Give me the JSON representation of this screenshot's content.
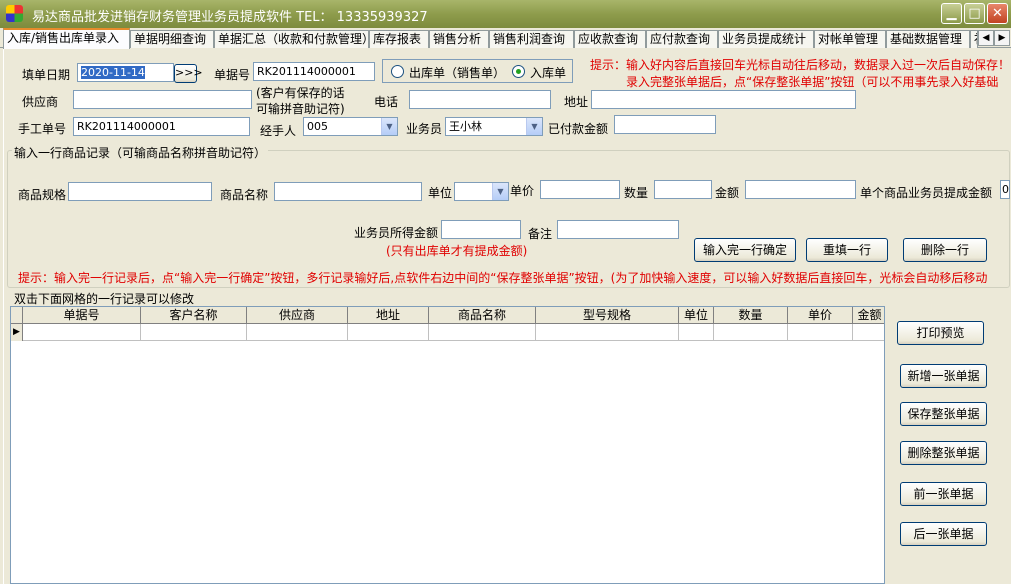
{
  "window": {
    "title": "易达商品批发进销存财务管理业务员提成软件 TEL： 13335939327",
    "min_label": "▁",
    "max_label": "□",
    "close_label": "✕"
  },
  "tabs": [
    {
      "label": "入库/销售出库单录入"
    },
    {
      "label": "单据明细查询"
    },
    {
      "label": "单据汇总（收款和付款管理）"
    },
    {
      "label": "库存报表"
    },
    {
      "label": "销售分析"
    },
    {
      "label": "销售利润查询"
    },
    {
      "label": "应收款查询"
    },
    {
      "label": "应付款查询"
    },
    {
      "label": "业务员提成统计"
    },
    {
      "label": "对帐单管理"
    },
    {
      "label": "基础数据管理"
    },
    {
      "label": "补"
    }
  ],
  "tab_scroll": {
    "left": "◀",
    "right": "▶"
  },
  "header": {
    "date_label": "填单日期",
    "date_value": "2020-11-14",
    "date_button": ">>>",
    "bill_no_label": "单据号",
    "bill_no_value": "RK201114000001",
    "radio_out_label": "出库单（销售单）",
    "radio_in_label": "入库单",
    "radio_selected": "入库单",
    "tip_line1": "提示：输入好内容后直接回车光标自动往后移动，数据录入过一次后自动保存！",
    "tip_line2": "录入完整张单据后，点“保存整张单据”按钮（可以不用事先录入好基础",
    "supplier_label": "供应商",
    "supplier_value": "",
    "supplier_hint_line1": "(客户有保存的话",
    "supplier_hint_line2": "可输拼音助记符)",
    "phone_label": "电话",
    "phone_value": "",
    "address_label": "地址",
    "address_value": "",
    "manual_no_label": "手工单号",
    "manual_no_value": "RK201114000001",
    "handler_label": "经手人",
    "handler_value": "005",
    "salesman_label": "业务员",
    "salesman_value": "王小林",
    "paid_label": "已付款金额",
    "paid_value": ""
  },
  "item_group": {
    "title": "输入一行商品记录（可输商品名称拼音助记符）",
    "spec_label": "商品规格",
    "name_label": "商品名称",
    "unit_label": "单位",
    "price_label": "单价",
    "qty_label": "数量",
    "amount_label": "金额",
    "commission_label": "单个商品业务员提成金额",
    "commission_value": "0",
    "salesman_amount_label": "业务员所得金额",
    "remark_label": "备注",
    "commission_note": "(只有出库单才有提成金额)",
    "confirm_button": "输入完一行确定",
    "refill_button": "重填一行",
    "delete_button": "删除一行",
    "bottom_tip": "提示：输入完一行记录后，点“输入完一行确定”按钮，多行记录输好后,点软件右边中间的“保存整张单据”按钮，(为了加快输入速度，可以输入好数据后直接回车，光标会自动移后移动"
  },
  "grid": {
    "caption": "双击下面网格的一行记录可以修改",
    "columns": [
      "单据号",
      "客户名称",
      "供应商",
      "地址",
      "商品名称",
      "型号规格",
      "单位",
      "数量",
      "单价",
      "金额"
    ],
    "row_indicator": "▶"
  },
  "side_buttons": {
    "print": "打印预览",
    "new_bill": "新增一张单据",
    "save_bill": "保存整张单据",
    "delete_bill": "删除整张单据",
    "prev_bill": "前一张单据",
    "next_bill": "后一张单据"
  },
  "colors": {
    "title_bar": "#8e9c4c",
    "tip_red": "#e00000",
    "selection": "#316ac5"
  }
}
